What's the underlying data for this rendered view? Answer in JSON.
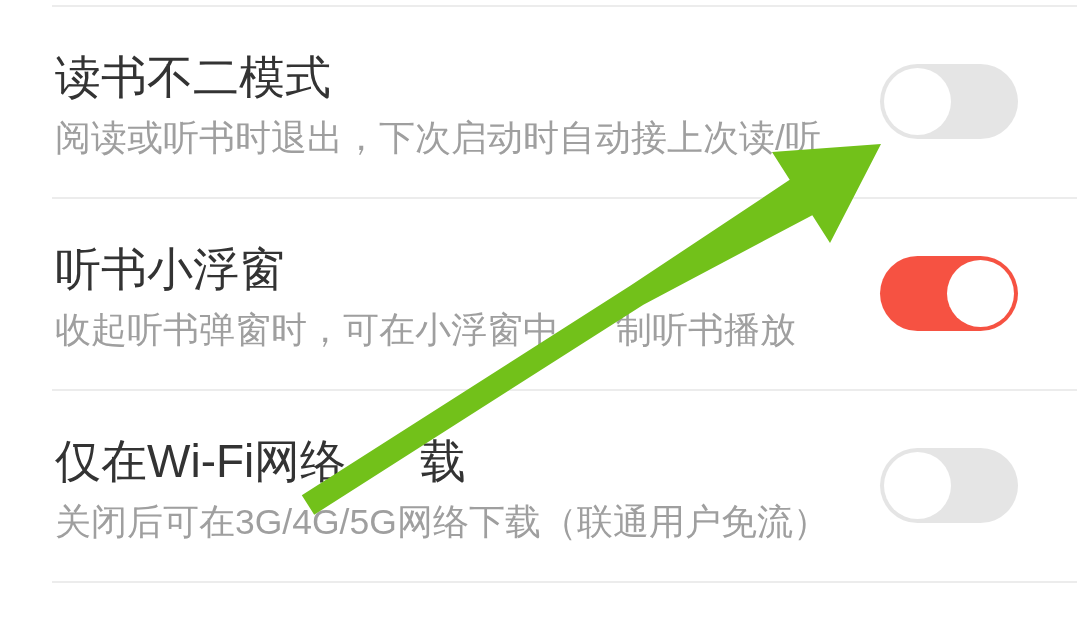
{
  "settings": [
    {
      "title": [
        "读书不二模式"
      ],
      "description": [
        "阅读或听书时退出，下次启动时自动接上次读/听"
      ],
      "on": false
    },
    {
      "title": [
        "听书小浮窗"
      ],
      "description": [
        "收起听书弹窗时，可在小浮窗中",
        "制听书播放"
      ],
      "on": true
    },
    {
      "title": [
        "仅在Wi-Fi网络",
        "载"
      ],
      "description": [
        "关闭后可在3G/4G/5G网络下载（联通用户免流）"
      ],
      "on": false
    }
  ]
}
